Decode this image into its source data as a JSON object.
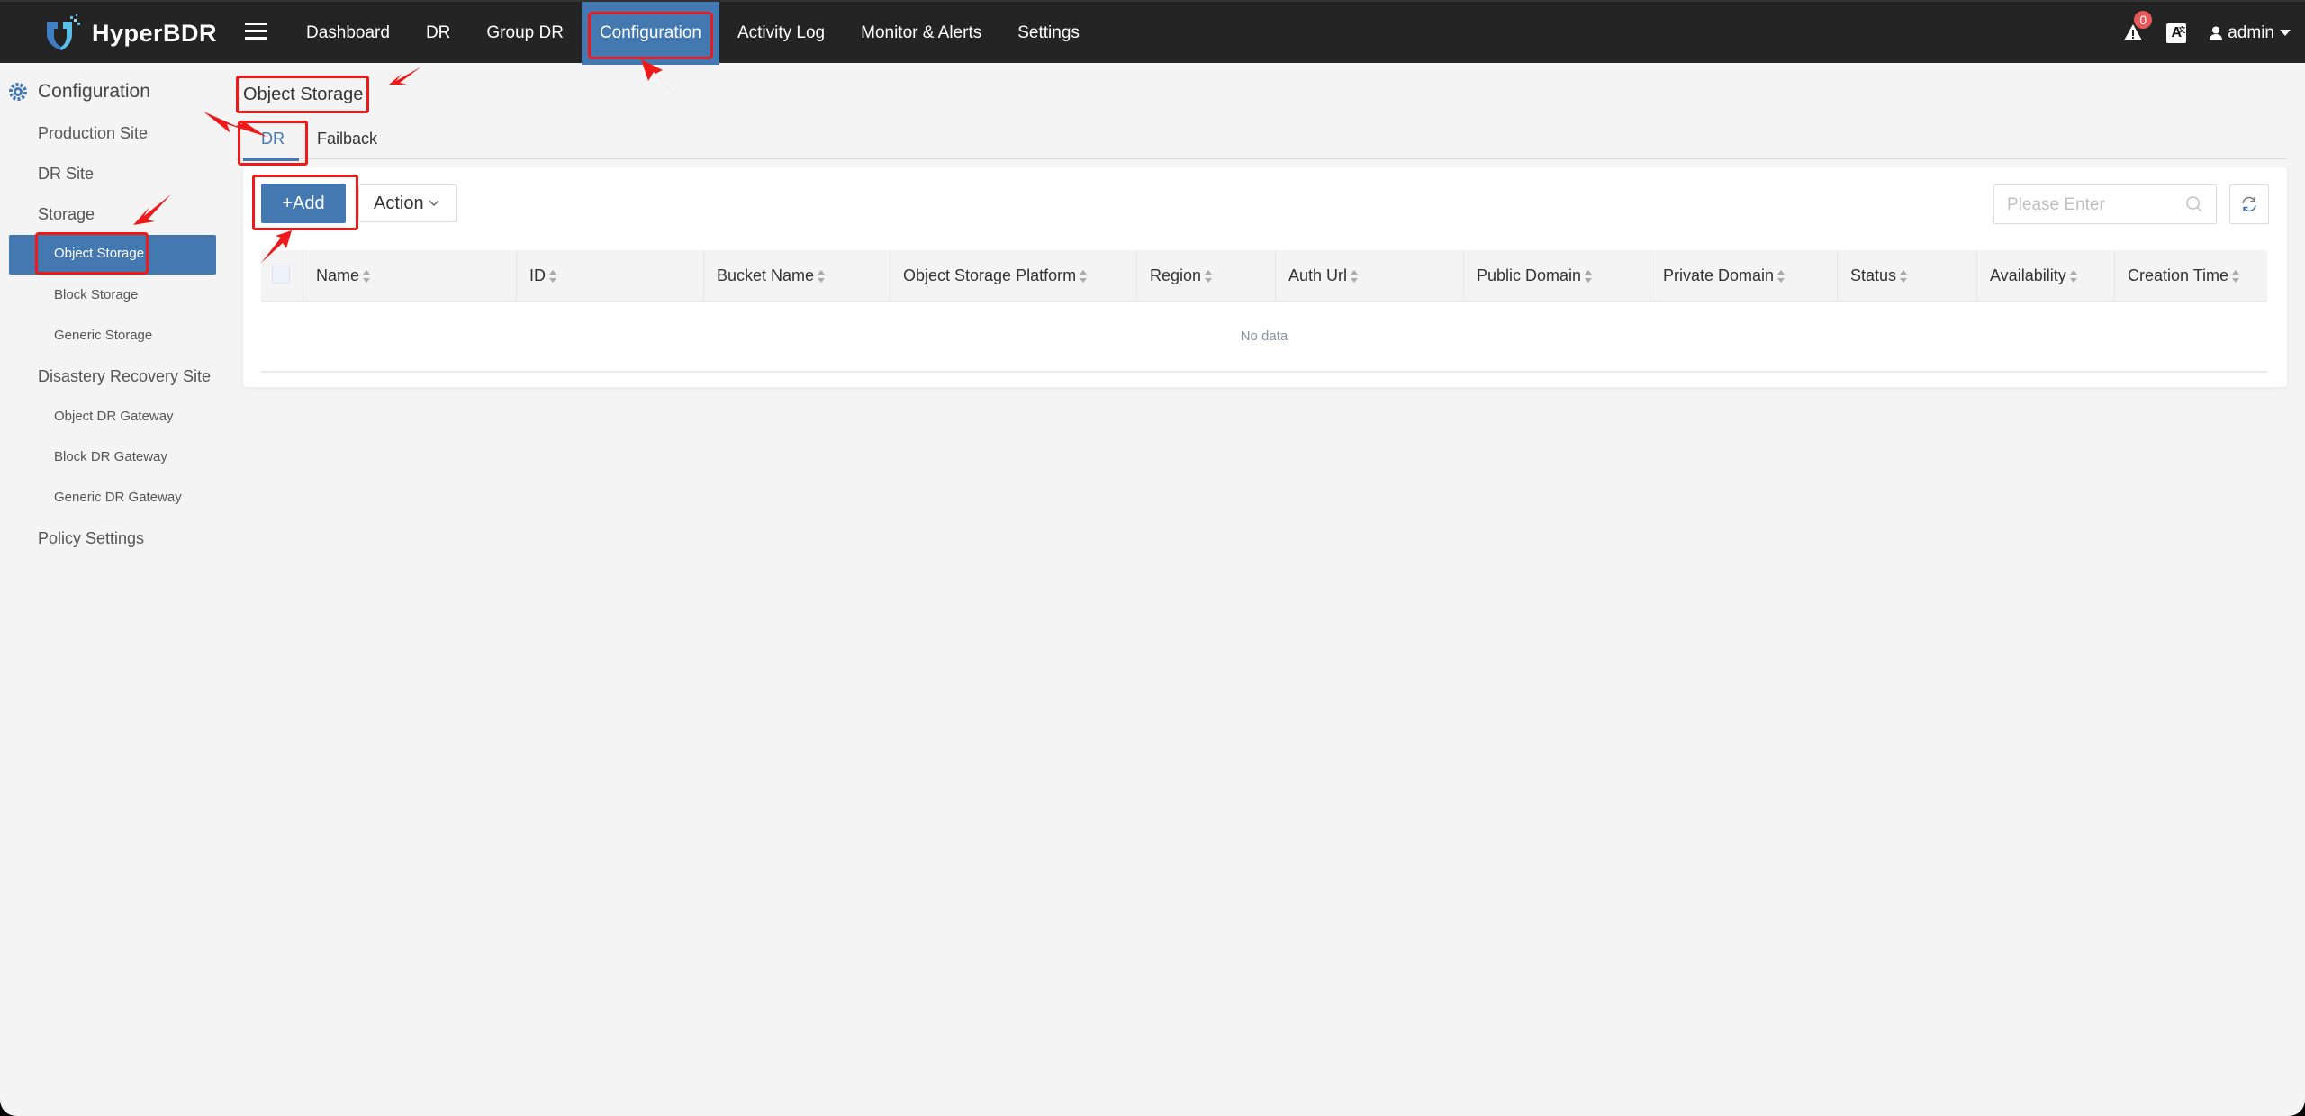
{
  "app": {
    "brand": "HyperBDR",
    "accent_color": "#4478b0",
    "highlight_color": "#f0191a"
  },
  "nav": {
    "menu_icon": "hamburger-icon",
    "items": [
      {
        "label": "Dashboard"
      },
      {
        "label": "DR"
      },
      {
        "label": "Group DR"
      },
      {
        "label": "Configuration",
        "active": true
      },
      {
        "label": "Activity Log"
      },
      {
        "label": "Monitor & Alerts"
      },
      {
        "label": "Settings"
      }
    ]
  },
  "topright": {
    "alert_count": "0",
    "language_icon_label": "A",
    "language_icon_sup": "文",
    "user": "admin"
  },
  "sidebar": {
    "header": "Configuration",
    "items": [
      {
        "label": "Production Site",
        "level": 1
      },
      {
        "label": "DR Site",
        "level": 1
      },
      {
        "label": "Storage",
        "level": 1
      },
      {
        "label": "Object Storage",
        "level": 2,
        "active": true
      },
      {
        "label": "Block Storage",
        "level": 2
      },
      {
        "label": "Generic Storage",
        "level": 2
      },
      {
        "label": "Disastery Recovery Site",
        "level": 1
      },
      {
        "label": "Object DR Gateway",
        "level": 2
      },
      {
        "label": "Block DR Gateway",
        "level": 2
      },
      {
        "label": "Generic DR Gateway",
        "level": 2
      },
      {
        "label": "Policy Settings",
        "level": 1
      }
    ]
  },
  "main": {
    "title": "Object Storage",
    "tabs": [
      {
        "label": "DR",
        "active": true
      },
      {
        "label": "Failback"
      }
    ],
    "toolbar": {
      "add_label": "+Add",
      "action_label": "Action",
      "search_placeholder": "Please Enter",
      "search_value": ""
    },
    "table": {
      "columns": [
        "Name",
        "ID",
        "Bucket Name",
        "Object Storage Platform",
        "Region",
        "Auth Url",
        "Public Domain",
        "Private Domain",
        "Status",
        "Availability",
        "Creation Time"
      ],
      "rows": [],
      "empty_text": "No data"
    }
  }
}
